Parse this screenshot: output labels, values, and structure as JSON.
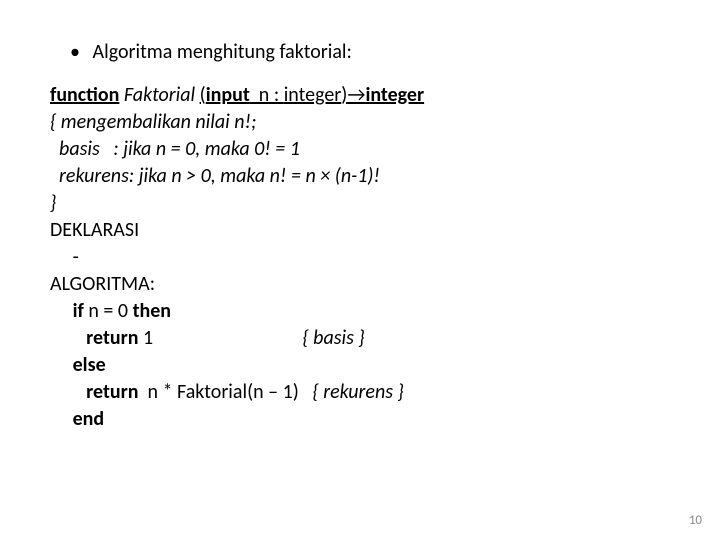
{
  "bullet": "Algoritma menghitung faktorial:",
  "sig": {
    "func": "function",
    "name": " Faktorial ",
    "lp": "(",
    "input": "input",
    "mid": "  n : ",
    "int1": "integer",
    "rp": ")",
    "arrow": "→",
    "int2": "integer"
  },
  "c1": "{ mengembalikan nilai n!;",
  "c2": "  basis   : jika n = 0, maka 0! = 1",
  "c3_a": "  rekurens: jika n > 0, maka n! = n ",
  "c3_b": " (n-1)!",
  "times": "×",
  "c4": "}",
  "dek": "DEKLARASI",
  "dash": "     -",
  "algo": "ALGORITMA:",
  "l_if_a": "     ",
  "l_if_b": "if",
  "l_if_c": " n = 0 ",
  "l_if_d": "then",
  "l_ret1_a": "        ",
  "l_ret1_b": "return",
  "l_ret1_c": " 1                                 ",
  "l_ret1_d": "{ basis }",
  "l_else_a": "     ",
  "l_else_b": "else",
  "l_ret2_a": "        ",
  "l_ret2_b": "return",
  "l_ret2_c": "  n * Faktorial(n – 1)   ",
  "l_ret2_d": "{ rekurens }",
  "l_end_a": "     ",
  "l_end_b": "end",
  "page": "10"
}
